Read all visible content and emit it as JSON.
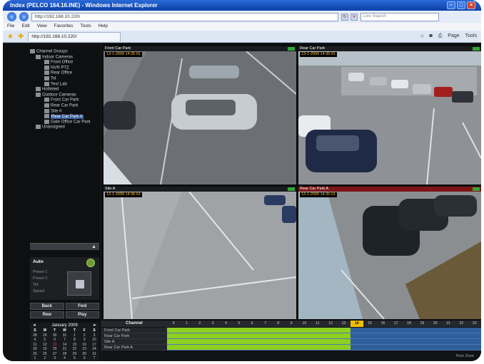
{
  "browser": {
    "title": "Index (PELCO 164.16.INE) - Windows Internet Explorer",
    "address": "http://192.168.10.220/",
    "search_placeholder": "Live Search",
    "menu": [
      "File",
      "Edit",
      "View",
      "Favorites",
      "Tools",
      "Help"
    ],
    "tab_title": "http://192.168.10.220/",
    "command_labels": [
      "Page",
      "Tools"
    ]
  },
  "sidebar": {
    "tree": [
      {
        "label": "Channel Groups",
        "level": 0
      },
      {
        "label": "Indoor Cameras",
        "level": 0
      },
      {
        "label": "Front Office",
        "level": 1
      },
      {
        "label": "NVR PTZ",
        "level": 1
      },
      {
        "label": "Rear Office",
        "level": 1
      },
      {
        "label": "Tst",
        "level": 1
      },
      {
        "label": "Test Lab",
        "level": 1
      },
      {
        "label": "Hotlisted",
        "level": 0
      },
      {
        "label": "Outdoor Cameras",
        "level": 0
      },
      {
        "label": "Front Car Park",
        "level": 1
      },
      {
        "label": "Rear Car Park",
        "level": 1
      },
      {
        "label": "Site A",
        "level": 1
      },
      {
        "label": "Rear Car Park A",
        "level": 1,
        "selected": true
      },
      {
        "label": "Gate Office Car Park",
        "level": 1
      },
      {
        "label": "Unassigned",
        "level": 0
      }
    ],
    "ptz": {
      "title": "Auto",
      "rows": [
        "Preset 1",
        "Preset 2",
        "Tilt",
        "Speed"
      ]
    },
    "buttons": [
      "Back",
      "Fwd",
      "Rew",
      "Play"
    ],
    "calendar": {
      "month": "January 2009",
      "days_header": [
        "S",
        "M",
        "T",
        "W",
        "T",
        "F",
        "S"
      ],
      "weeks": [
        [
          "28",
          "29",
          "30",
          "31",
          "1",
          "2",
          "3"
        ],
        [
          "4",
          "5",
          "6",
          "7",
          "8",
          "9",
          "10"
        ],
        [
          "11",
          "12",
          "13",
          "14",
          "15",
          "16",
          "17"
        ],
        [
          "18",
          "19",
          "20",
          "21",
          "22",
          "23",
          "24"
        ],
        [
          "25",
          "26",
          "27",
          "28",
          "29",
          "30",
          "31"
        ],
        [
          "1",
          "2",
          "3",
          "4",
          "5",
          "6",
          "7"
        ]
      ],
      "highlight": "13"
    }
  },
  "cameras": [
    {
      "name": "Front Car Park",
      "timestamp": "13-1-2009 14:35:01"
    },
    {
      "name": "Rear Car Park",
      "timestamp": "13-1-2009 14:35:01"
    },
    {
      "name": "Site A",
      "timestamp": "13-1-2009 14:35:01"
    },
    {
      "name": "Rear Car Park A",
      "timestamp": "13-1-2009 14:35:01"
    }
  ],
  "timeline": {
    "channel_header": "Channel",
    "hours": [
      "0",
      "1",
      "2",
      "3",
      "4",
      "5",
      "6",
      "7",
      "8",
      "9",
      "10",
      "11",
      "12",
      "13",
      "14",
      "15",
      "16",
      "17",
      "18",
      "19",
      "20",
      "21",
      "22",
      "23"
    ],
    "current_hour": "14",
    "channels": [
      "Front Car Park",
      "Rear Car Park",
      "Site A",
      "Rear Car Park A"
    ],
    "fill_fraction": 0.585,
    "footer": "Time Zone"
  },
  "colors": {
    "recording": "#8fd020",
    "track": "#2f5e9c",
    "selection": "#3a5f9e"
  }
}
